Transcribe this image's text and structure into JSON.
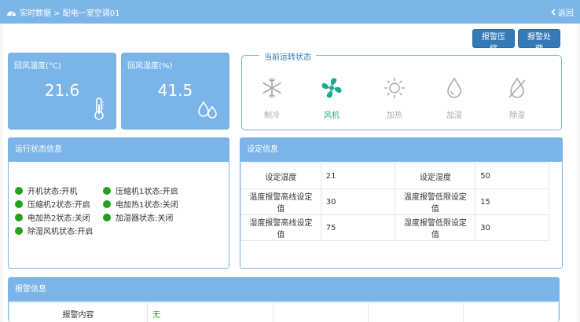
{
  "header": {
    "breadcrumb": "实时数据 > 配电一室空调01",
    "back_label": "返回"
  },
  "toolbar": {
    "compress_label": "报警压缩",
    "handle_label": "报警处理"
  },
  "cards": {
    "temp": {
      "title": "回风温度(°C)",
      "value": "21.6"
    },
    "humi": {
      "title": "回风湿度(%)",
      "value": "41.5"
    }
  },
  "status": {
    "legend": "当前运转状态",
    "modes": [
      {
        "label": "制冷",
        "icon": "snowflake-icon",
        "active": false
      },
      {
        "label": "风机",
        "icon": "fan-icon",
        "active": true
      },
      {
        "label": "加热",
        "icon": "sun-icon",
        "active": false
      },
      {
        "label": "加湿",
        "icon": "water-drop-icon",
        "active": false
      },
      {
        "label": "除湿",
        "icon": "dehumidify-icon",
        "active": false
      }
    ]
  },
  "run_panel": {
    "title": "运行状态信息",
    "items": [
      "开机状态:开机",
      "压缩机1状态:开启",
      "压缩机2状态:开启",
      "电加热1状态:关闭",
      "电加热2状态:关闭",
      "加湿器状态:关闭",
      "除湿风机状态:开启"
    ]
  },
  "settings_panel": {
    "title": "设定信息",
    "rows": [
      [
        "设定温度",
        "21",
        "设定湿度",
        "50"
      ],
      [
        "温度报警高线设定值",
        "30",
        "温度报警低限设定值",
        "15"
      ],
      [
        "湿度报警高线设定值",
        "75",
        "湿度报警低限设定值",
        "30"
      ]
    ]
  },
  "alarm_panel": {
    "title": "报警信息",
    "key": "报警内容",
    "value": "无"
  },
  "colors": {
    "header": "#7cb6e8",
    "card": "#7ab4e9",
    "button": "#337ab7",
    "active_mode": "#1aaa8e",
    "status_on": "#23a01e"
  }
}
